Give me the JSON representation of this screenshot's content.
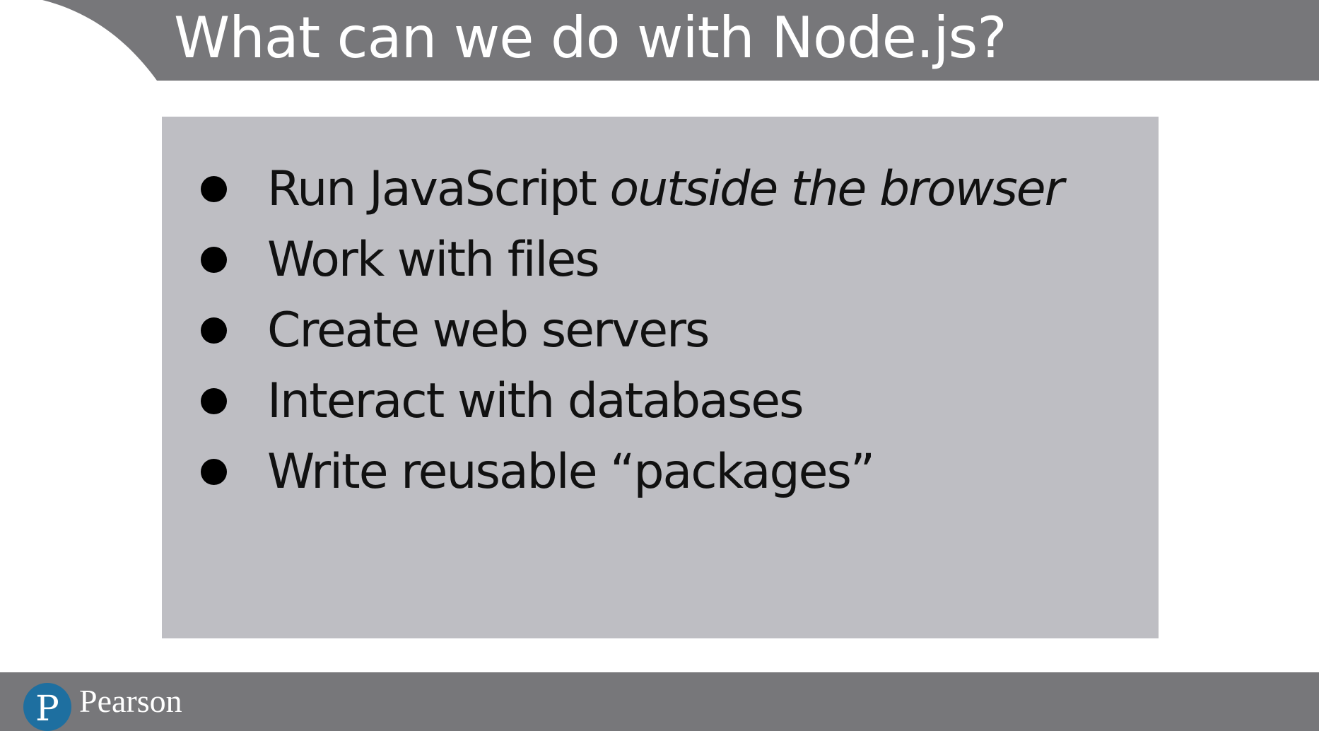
{
  "slide": {
    "title": "What can we do with Node.js?"
  },
  "bullets": [
    {
      "text": "Run JavaScript ",
      "emphasis": "outside the browser"
    },
    {
      "text": "Work with files",
      "emphasis": ""
    },
    {
      "text": "Create web servers",
      "emphasis": ""
    },
    {
      "text": "Interact with databases",
      "emphasis": ""
    },
    {
      "text": "Write reusable “packages”",
      "emphasis": ""
    }
  ],
  "footer": {
    "logo_letter": "P",
    "brand": "Pearson"
  },
  "colors": {
    "header_bar": "#77777a",
    "content_box": "#bebec3",
    "logo": "#1e6fa0",
    "title_text": "#ffffff"
  }
}
